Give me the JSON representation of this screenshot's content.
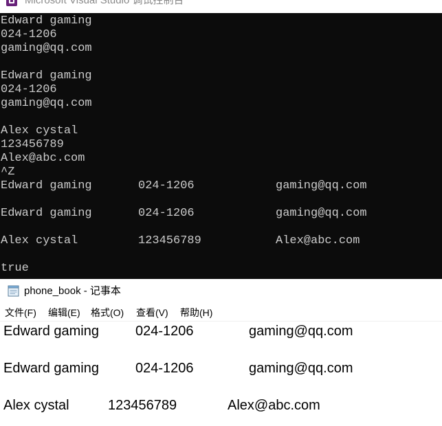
{
  "vs_console": {
    "window_title": "Microsoft Visual Studio 调试控制台",
    "lines": [
      "Edward gaming",
      "024-1206",
      "gaming@qq.com",
      "",
      "Edward gaming",
      "024-1206",
      "gaming@qq.com",
      "",
      "Alex cystal",
      "123456789",
      "Alex@abc.com",
      "^Z"
    ],
    "table_rows": [
      {
        "name": "Edward gaming",
        "phone": "024-1206",
        "email": "gaming@qq.com"
      },
      {
        "name": "Edward gaming",
        "phone": "024-1206",
        "email": "gaming@qq.com"
      },
      {
        "name": "Alex cystal",
        "phone": "123456789",
        "email": "Alex@abc.com"
      }
    ],
    "result": "true"
  },
  "notepad": {
    "window_title": "phone_book - 记事本",
    "menu": [
      "文件(F)",
      "编辑(E)",
      "格式(O)",
      "查看(V)",
      "帮助(H)"
    ],
    "rows": [
      {
        "name": "Edward gaming",
        "phone": "024-1206",
        "email": "gaming@qq.com"
      },
      {
        "name": "Edward gaming",
        "phone": "024-1206",
        "email": "gaming@qq.com"
      },
      {
        "name": "Alex cystal",
        "phone": "123456789",
        "email": "Alex@abc.com"
      }
    ]
  },
  "colors": {
    "console_background": "#0c0c0c",
    "console_text": "#cccccc",
    "vs_accent": "#68217a"
  },
  "icons": {
    "vs_app": "visual-studio-icon",
    "notepad_app": "notepad-icon"
  }
}
